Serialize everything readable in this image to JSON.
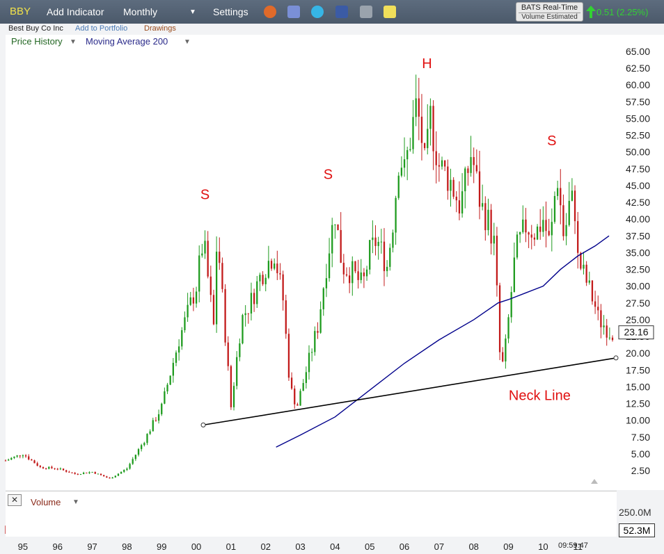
{
  "toolbar": {
    "ticker": "BBY",
    "add_indicator": "Add Indicator",
    "period": "Monthly",
    "settings": "Settings",
    "bats_title": "BATS Real-Time",
    "bats_sub": "Volume Estimated",
    "change": "0.51 (2.25%)"
  },
  "subbar": {
    "company": "Best Buy Co Inc",
    "add_portfolio": "Add to Portfolio",
    "drawings": "Drawings"
  },
  "legend": {
    "price_history": "Price History",
    "moving_average": "Moving Average 200"
  },
  "colors": {
    "up": "#1e9b1e",
    "down": "#c21a1a",
    "ma": "#00008b",
    "annotation": "#e01010",
    "neckline": "#000000"
  },
  "volume_panel": {
    "label": "Volume",
    "close_icon": "x-icon",
    "max_label": "250.0M",
    "current_label": "52.3M"
  },
  "time": "09:59:47",
  "chart_data": {
    "type": "candlestick",
    "ylim": [
      0,
      66
    ],
    "yticks": [
      "65.00",
      "62.50",
      "60.00",
      "57.50",
      "55.00",
      "52.50",
      "50.00",
      "47.50",
      "45.00",
      "42.50",
      "40.00",
      "37.50",
      "35.00",
      "32.50",
      "30.00",
      "27.50",
      "25.00",
      "22.50",
      "20.00",
      "17.50",
      "15.00",
      "12.50",
      "10.00",
      "7.50",
      "5.00",
      "2.50"
    ],
    "xticks": [
      "95",
      "96",
      "97",
      "98",
      "99",
      "00",
      "01",
      "02",
      "03",
      "04",
      "05",
      "06",
      "07",
      "08",
      "09",
      "10",
      "11"
    ],
    "x_start_year": 1994.5,
    "x_end_year": 2012.1,
    "current_price": "23.16",
    "anchors": [
      [
        1994.5,
        4.0
      ],
      [
        1995.0,
        5.0
      ],
      [
        1995.5,
        3.0
      ],
      [
        1996.0,
        2.8
      ],
      [
        1996.5,
        2.0
      ],
      [
        1997.0,
        2.3
      ],
      [
        1997.5,
        1.3
      ],
      [
        1998.0,
        2.8
      ],
      [
        1998.5,
        7.0
      ],
      [
        1999.0,
        12.0
      ],
      [
        1999.5,
        22.0
      ],
      [
        2000.0,
        30.0
      ],
      [
        2000.2,
        37.0
      ],
      [
        2000.5,
        24.0
      ],
      [
        2000.6,
        38.0
      ],
      [
        2000.8,
        25.0
      ],
      [
        2001.0,
        12.0
      ],
      [
        2001.3,
        25.0
      ],
      [
        2001.6,
        28.0
      ],
      [
        2001.8,
        31.0
      ],
      [
        2002.0,
        33.0
      ],
      [
        2002.25,
        35.0
      ],
      [
        2002.5,
        28.0
      ],
      [
        2002.7,
        15.0
      ],
      [
        2002.9,
        12.0
      ],
      [
        2003.2,
        18.0
      ],
      [
        2003.5,
        24.0
      ],
      [
        2003.8,
        35.0
      ],
      [
        2004.0,
        41.0
      ],
      [
        2004.2,
        33.0
      ],
      [
        2004.5,
        32.0
      ],
      [
        2004.8,
        30.0
      ],
      [
        2005.0,
        35.0
      ],
      [
        2005.2,
        37.0
      ],
      [
        2005.5,
        33.0
      ],
      [
        2005.7,
        41.0
      ],
      [
        2005.85,
        50.0
      ],
      [
        2006.0,
        47.0
      ],
      [
        2006.2,
        53.0
      ],
      [
        2006.35,
        57.0
      ],
      [
        2006.5,
        52.0
      ],
      [
        2006.6,
        47.0
      ],
      [
        2006.75,
        55.0
      ],
      [
        2007.0,
        48.0
      ],
      [
        2007.3,
        46.0
      ],
      [
        2007.6,
        42.0
      ],
      [
        2007.8,
        46.0
      ],
      [
        2007.9,
        50.0
      ],
      [
        2008.0,
        48.0
      ],
      [
        2008.2,
        42.0
      ],
      [
        2008.4,
        40.0
      ],
      [
        2008.6,
        36.0
      ],
      [
        2008.75,
        20.0
      ],
      [
        2008.85,
        18.0
      ],
      [
        2009.0,
        25.0
      ],
      [
        2009.2,
        35.0
      ],
      [
        2009.5,
        39.0
      ],
      [
        2009.8,
        38.0
      ],
      [
        2010.0,
        40.0
      ],
      [
        2010.2,
        36.0
      ],
      [
        2010.4,
        47.0
      ],
      [
        2010.6,
        37.0
      ],
      [
        2010.75,
        42.0
      ],
      [
        2010.9,
        43.0
      ],
      [
        2011.0,
        34.0
      ],
      [
        2011.3,
        30.0
      ],
      [
        2011.5,
        27.0
      ],
      [
        2011.6,
        25.0
      ],
      [
        2011.8,
        24.0
      ],
      [
        2011.9,
        23.2
      ],
      [
        2012.0,
        23.16
      ]
    ],
    "moving_average": [
      [
        2002.3,
        6.0
      ],
      [
        2003.0,
        7.8
      ],
      [
        2004.0,
        10.5
      ],
      [
        2005.0,
        14.5
      ],
      [
        2006.0,
        18.5
      ],
      [
        2007.0,
        22.0
      ],
      [
        2008.0,
        25.0
      ],
      [
        2008.7,
        27.5
      ],
      [
        2009.0,
        28.0
      ],
      [
        2009.5,
        29.0
      ],
      [
        2010.0,
        30.0
      ],
      [
        2010.5,
        32.5
      ],
      [
        2011.0,
        34.5
      ],
      [
        2011.5,
        36.0
      ],
      [
        2011.9,
        37.5
      ]
    ],
    "neckline": {
      "from": [
        2000.2,
        9.3
      ],
      "to": [
        2012.1,
        19.3
      ]
    },
    "annotations": [
      {
        "text": "S",
        "x": 2000.25,
        "y": 43.0
      },
      {
        "text": "S",
        "x": 2003.8,
        "y": 46.0
      },
      {
        "text": "H",
        "x": 2006.65,
        "y": 62.5
      },
      {
        "text": "S",
        "x": 2010.25,
        "y": 51.0
      },
      {
        "text": "Neck Line",
        "x": 2009.9,
        "y": 13.0
      }
    ]
  }
}
